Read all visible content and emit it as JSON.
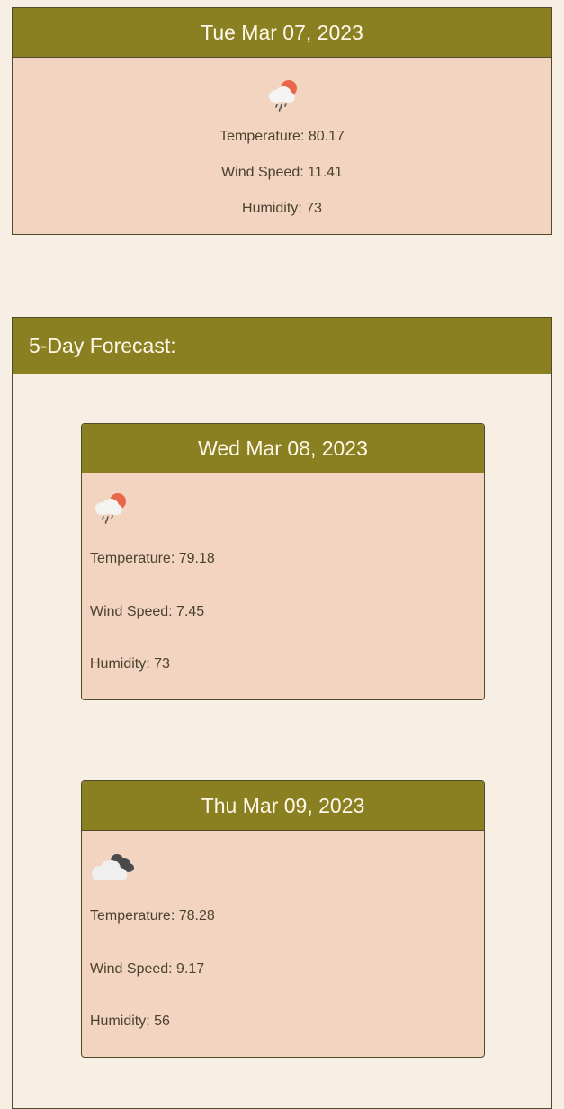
{
  "current": {
    "date": "Tue Mar 07, 2023",
    "icon": "rain-sun-icon",
    "temperature": "Temperature: 80.17",
    "wind": "Wind Speed: 11.41",
    "humidity": "Humidity: 73"
  },
  "forecast": {
    "title": "5-Day Forecast:",
    "days": [
      {
        "date": "Wed Mar 08, 2023",
        "icon": "rain-sun-icon",
        "temperature": "Temperature: 79.18",
        "wind": "Wind Speed: 7.45",
        "humidity": "Humidity: 73"
      },
      {
        "date": "Thu Mar 09, 2023",
        "icon": "cloudy-icon",
        "temperature": "Temperature: 78.28",
        "wind": "Wind Speed: 9.17",
        "humidity": "Humidity: 56"
      }
    ]
  },
  "colors": {
    "page_bg": "#f7efe3",
    "header_bg": "#8a8022",
    "card_bg": "#f2d4c0",
    "sun": "#e8664a"
  }
}
